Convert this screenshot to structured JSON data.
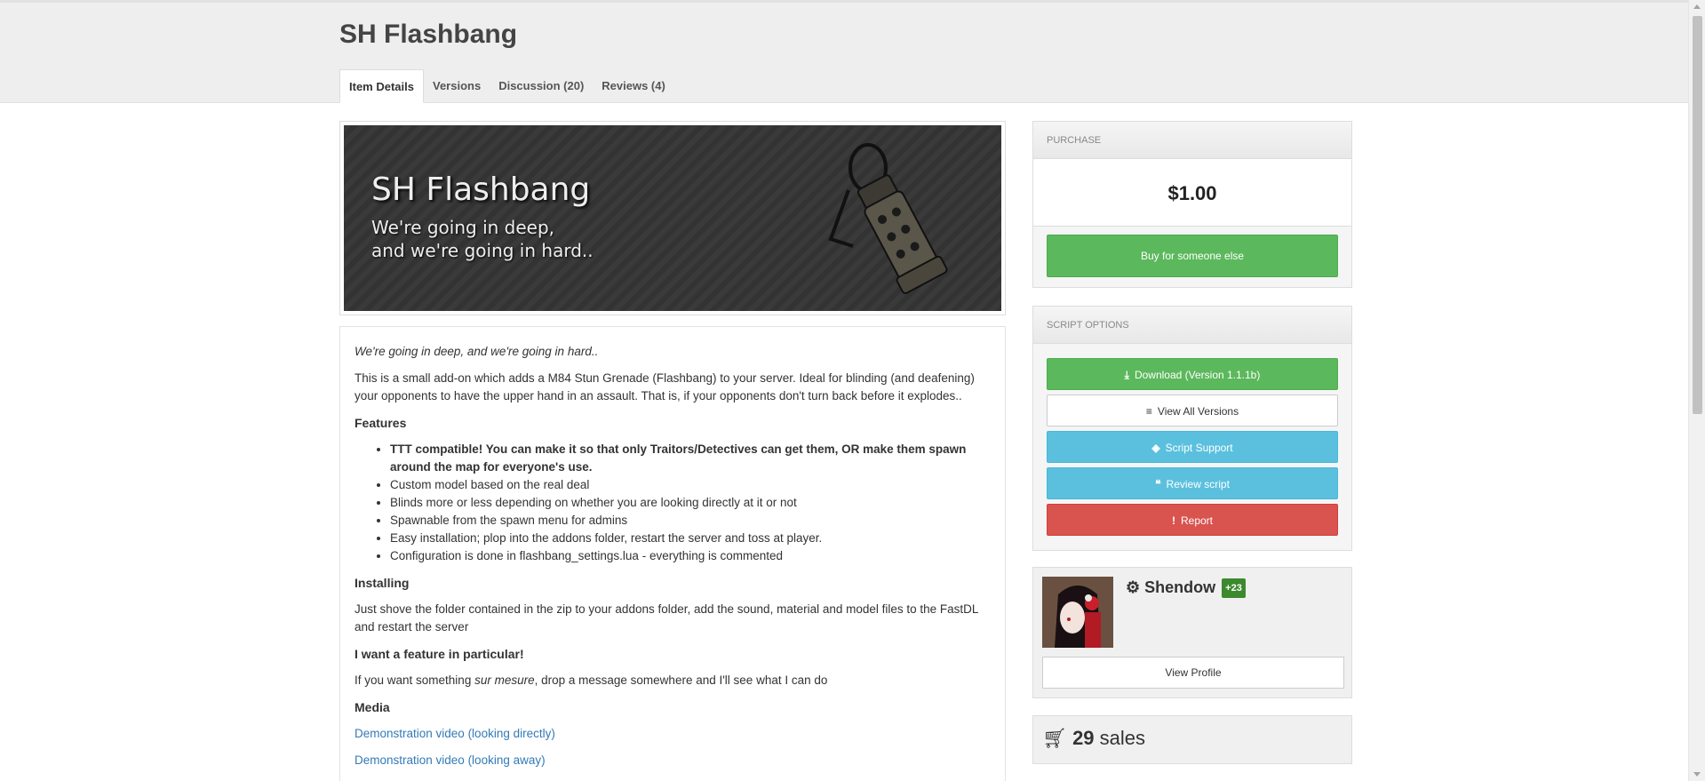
{
  "page": {
    "title": "SH Flashbang"
  },
  "tabs": [
    "Item Details",
    "Versions",
    "Discussion (20)",
    "Reviews (4)"
  ],
  "banner": {
    "title": "SH Flashbang",
    "subtitle_line1": "We're going in deep,",
    "subtitle_line2": "and we're going in hard.."
  },
  "description": {
    "tagline": "We're going in deep, and we're going in hard..",
    "intro": "This is a small add-on which adds a M84 Stun Grenade (Flashbang) to your server. Ideal for blinding (and deafening) your opponents to have the upper hand in an assault. That is, if your opponents don't turn back before it explodes..",
    "features_heading": "Features",
    "features": [
      "TTT compatible! You can make it so that only Traitors/Detectives can get them, OR make them spawn around the map for everyone's use.",
      "Custom model based on the real deal",
      "Blinds more or less depending on whether you are looking directly at it or not",
      "Spawnable from the spawn menu for admins",
      "Easy installation; plop into the addons folder, restart the server and toss at player.",
      "Configuration is done in flashbang_settings.lua - everything is commented"
    ],
    "installing_heading": "Installing",
    "installing_text": "Just shove the folder contained in the zip to your addons folder, add the sound, material and model files to the FastDL and restart the server",
    "feature_req_heading": "I want a feature in particular!",
    "feature_req_pre": "If you want something ",
    "feature_req_em": "sur mesure",
    "feature_req_post": ", drop a message somewhere and I'll see what I can do",
    "media_heading": "Media",
    "media_links": [
      "Demonstration video (looking directly)",
      "Demonstration video (looking away)"
    ]
  },
  "purchase": {
    "heading": "PURCHASE",
    "price": "$1.00",
    "buy_other_label": "Buy for someone else"
  },
  "script_options": {
    "heading": "SCRIPT OPTIONS",
    "download_label": "Download (Version 1.1.1b)",
    "versions_label": "View All Versions",
    "support_label": "Script Support",
    "review_label": "Review script",
    "report_label": "Report"
  },
  "author": {
    "name": "Shendow",
    "reputation": "+23",
    "view_profile_label": "View Profile"
  },
  "sales": {
    "count": "29",
    "label": "sales"
  },
  "colors": {
    "green": "#5cb85c",
    "blue": "#5bc0de",
    "red": "#d9534f",
    "link": "#337ab7"
  }
}
